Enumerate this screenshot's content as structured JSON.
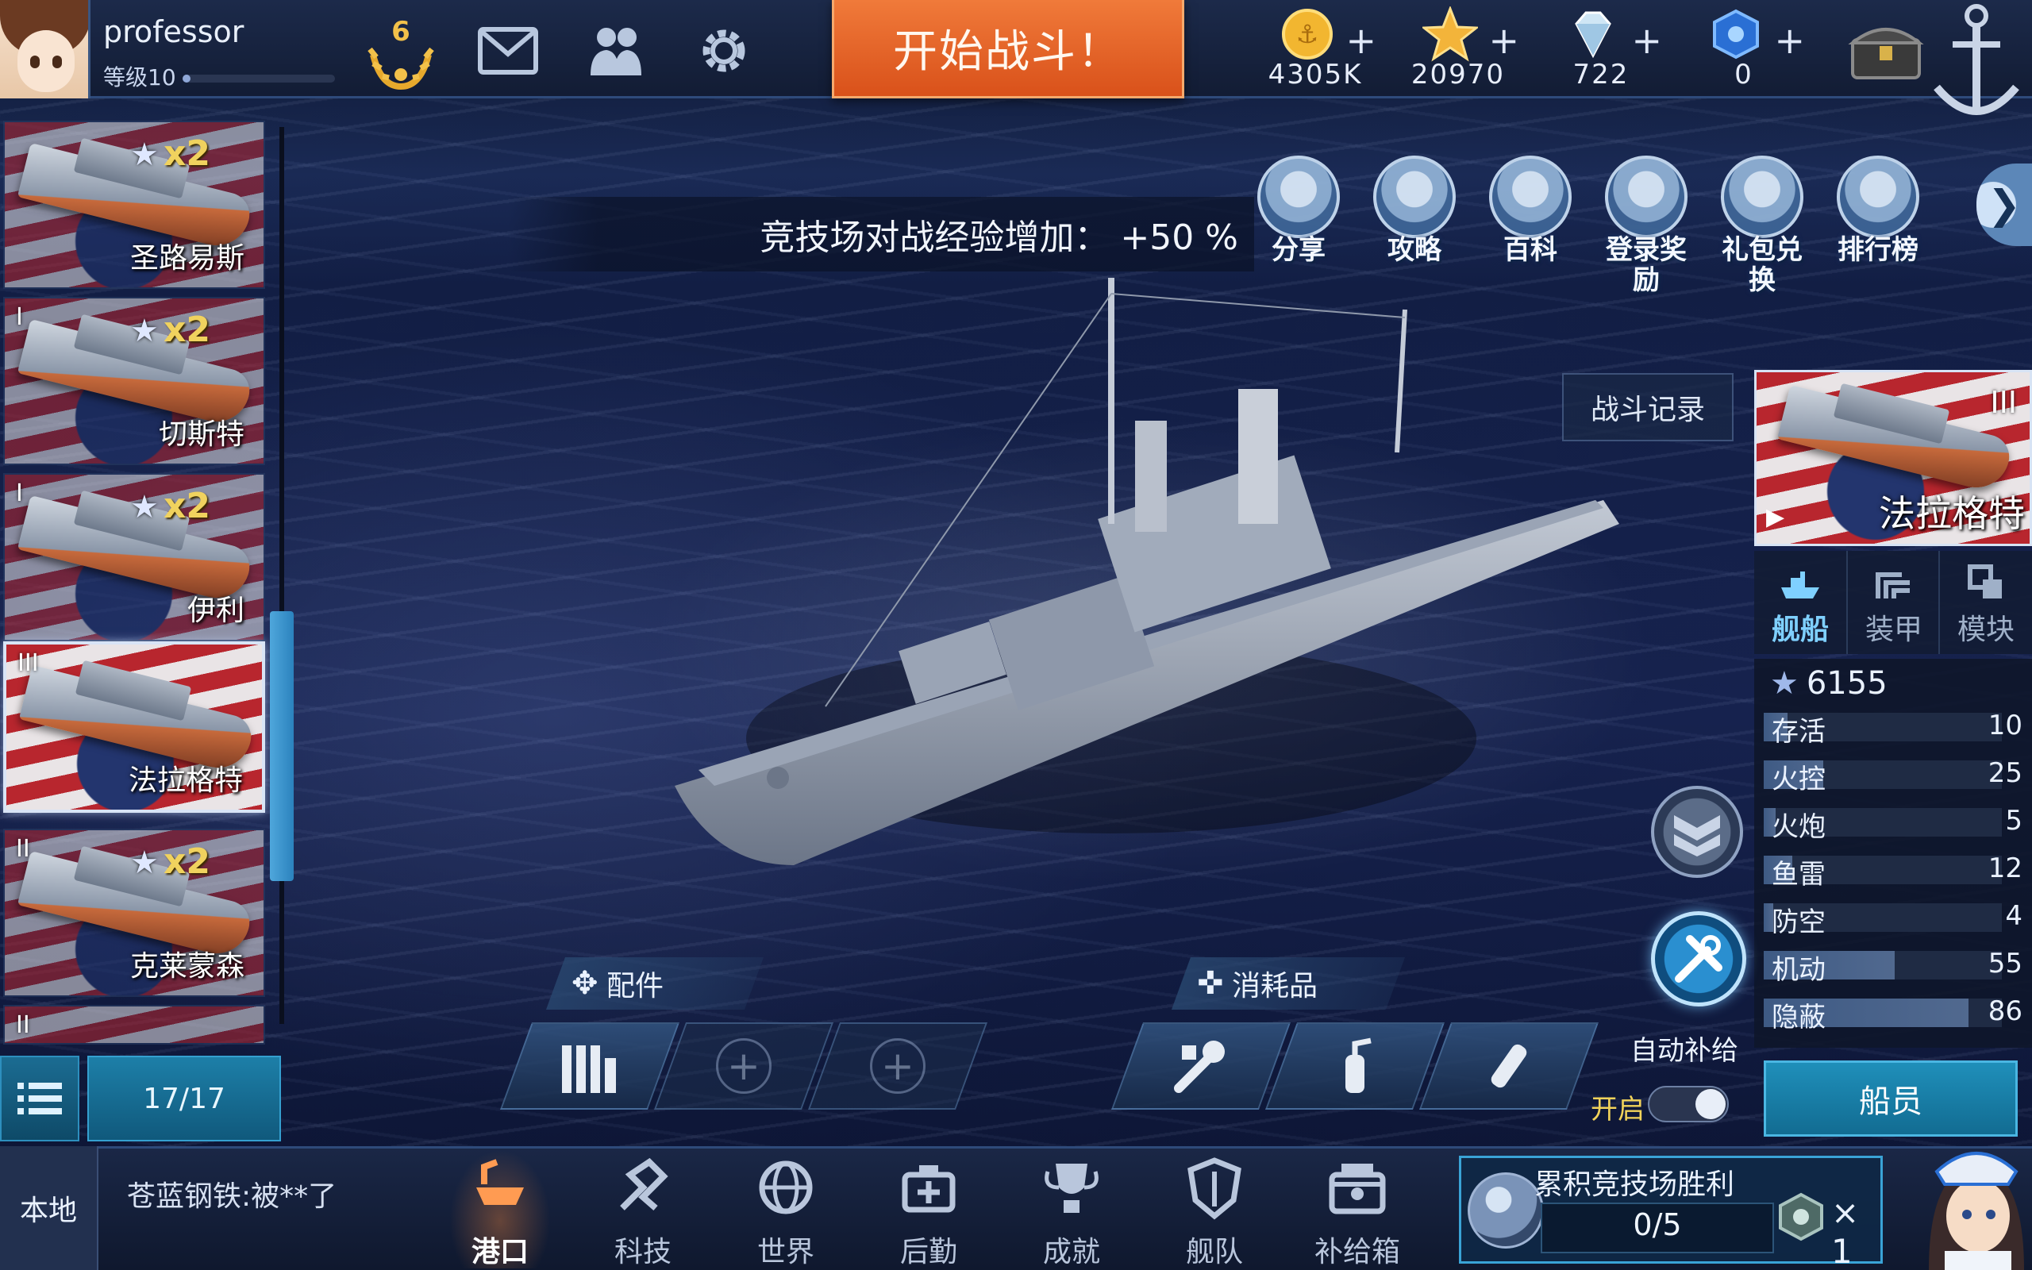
{
  "player": {
    "name": "professor",
    "level_label": "等级10",
    "xp_progress": 0.05
  },
  "rank": {
    "value": "6"
  },
  "start_battle": "开始战斗！",
  "currencies": [
    {
      "name": "gold",
      "value": "4305K",
      "icon": "gold-coin-icon"
    },
    {
      "name": "star",
      "value": "20970",
      "icon": "star-icon"
    },
    {
      "name": "diamond",
      "value": "722",
      "icon": "diamond-icon"
    },
    {
      "name": "blue-gem",
      "value": "0",
      "icon": "blue-gem-icon"
    }
  ],
  "banner": "竞技场对战经验增加： +50 %",
  "features": [
    {
      "label": "分享",
      "icon": "share-icon"
    },
    {
      "label": "攻略",
      "icon": "guide-house-icon"
    },
    {
      "label": "百科",
      "icon": "encyclopedia-icon"
    },
    {
      "label": "登录奖励",
      "icon": "login-reward-icon"
    },
    {
      "label": "礼包兑换",
      "icon": "gift-exchange-icon"
    },
    {
      "label": "排行榜",
      "icon": "leaderboard-icon"
    }
  ],
  "battle_record": "战斗记录",
  "ships": [
    {
      "name": "圣路易斯",
      "mult": "x2",
      "tier": ""
    },
    {
      "name": "切斯特",
      "mult": "x2",
      "tier": "I"
    },
    {
      "name": "伊利",
      "mult": "x2",
      "tier": "I"
    },
    {
      "name": "法拉格特",
      "mult": "",
      "tier": "III"
    },
    {
      "name": "克莱蒙森",
      "mult": "x2",
      "tier": "II"
    },
    {
      "name": "",
      "mult": "",
      "tier": "II"
    }
  ],
  "list_count": "17/17",
  "selected_ship": {
    "name": "法拉格特",
    "tier": "III"
  },
  "tabs": [
    {
      "label": "舰船",
      "icon": "ship-tab-icon",
      "active": true
    },
    {
      "label": "装甲",
      "icon": "armor-tab-icon",
      "active": false
    },
    {
      "label": "模块",
      "icon": "module-tab-icon",
      "active": false
    }
  ],
  "power": "6155",
  "stats": [
    {
      "name": "存活",
      "value": 10
    },
    {
      "name": "火控",
      "value": 25
    },
    {
      "name": "火炮",
      "value": 5
    },
    {
      "name": "鱼雷",
      "value": 12
    },
    {
      "name": "防空",
      "value": 4
    },
    {
      "name": "机动",
      "value": 55
    },
    {
      "name": "隐蔽",
      "value": 86
    }
  ],
  "crew_button": "船员",
  "equipment": {
    "label": "配件"
  },
  "consumables": {
    "label": "消耗品"
  },
  "auto_supply": {
    "label": "自动补给",
    "toggle_label": "开启",
    "on": true
  },
  "bottom": {
    "local": "本地",
    "chat": "苍蓝钢铁:被**了",
    "nav": [
      {
        "label": "港口",
        "icon": "port-icon",
        "active": true
      },
      {
        "label": "科技",
        "icon": "tech-icon",
        "active": false
      },
      {
        "label": "世界",
        "icon": "world-globe-icon",
        "active": false
      },
      {
        "label": "后勤",
        "icon": "logistics-icon",
        "active": false
      },
      {
        "label": "成就",
        "icon": "achievement-icon",
        "active": false
      },
      {
        "label": "舰队",
        "icon": "fleet-shield-icon",
        "active": false
      },
      {
        "label": "补给箱",
        "icon": "supply-box-icon",
        "active": false
      }
    ],
    "arena": {
      "title": "累积竞技场胜利",
      "progress": "0/5",
      "reward_count": "× 1"
    }
  },
  "colors": {
    "start_battle": "#d9511a",
    "accent_blue": "#1f8fba",
    "gold": "#f2c14a"
  }
}
